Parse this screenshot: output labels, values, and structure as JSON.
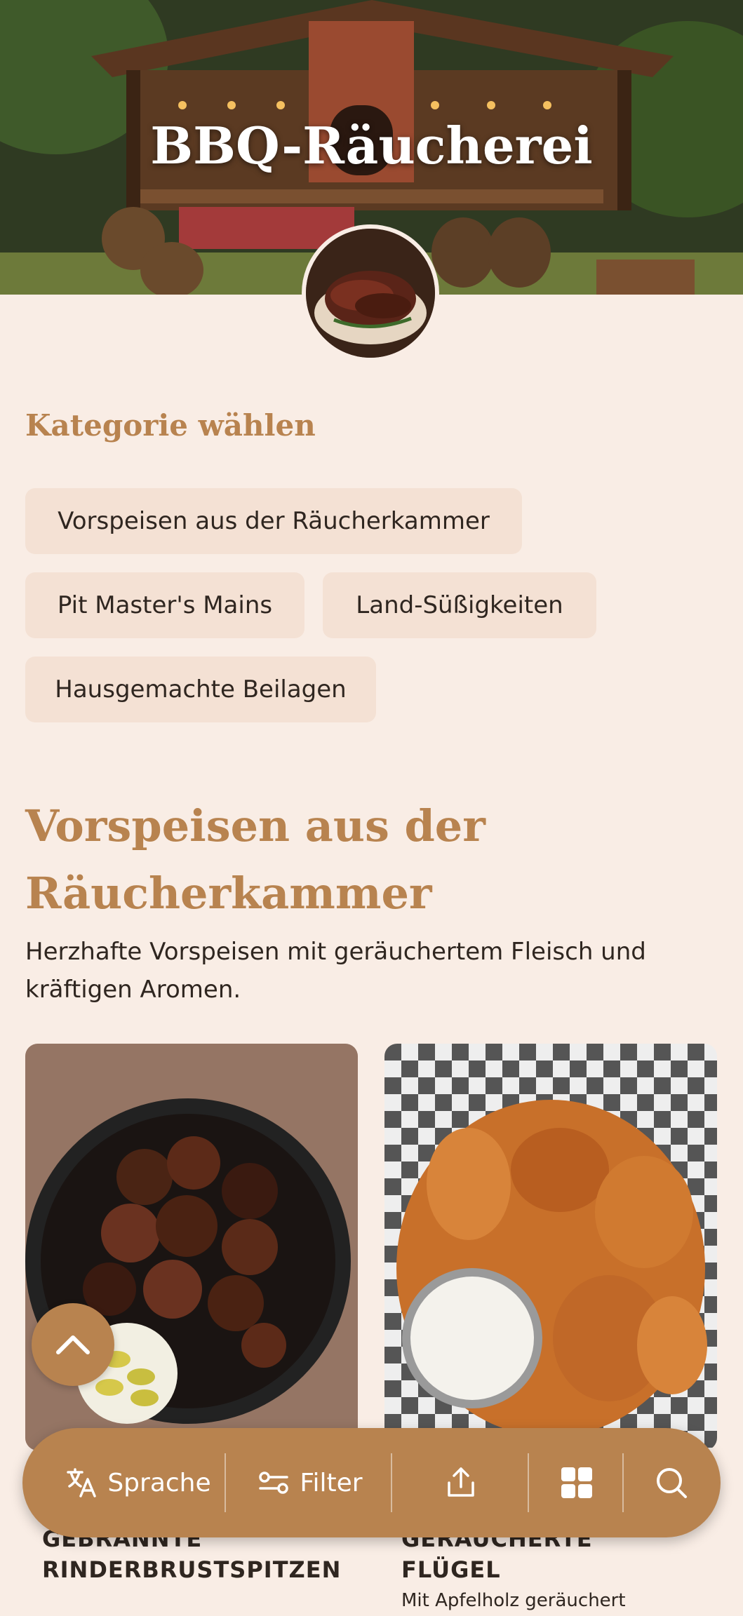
{
  "header": {
    "title": "BBQ-Räucherei"
  },
  "category_picker": {
    "label": "Kategorie wählen",
    "chips": [
      "Vorspeisen aus der Räucherkammer",
      "Pit Master's Mains",
      "Land-Süßigkeiten",
      "Hausgemachte Beilagen"
    ]
  },
  "category": {
    "title": "Vorspeisen aus der Räucherkammer",
    "description": "Herzhafte Vorspeisen mit geräuchertem Fleisch und kräftigen Aromen."
  },
  "items": [
    {
      "title_line1": "GEBRANNTE",
      "title_line2": "RINDERBRUSTSPITZEN"
    },
    {
      "title_line1": "GERÄUCHERTE FLÜGEL",
      "subtitle": "Mit Apfelholz geräuchert"
    }
  ],
  "bottom_bar": {
    "language_label": "Sprache",
    "filter_label": "Filter"
  },
  "colors": {
    "accent": "#b8834f",
    "background": "#f9ede5",
    "chip": "#f4e1d4",
    "text": "#2f2620"
  },
  "icons": [
    "translate-icon",
    "filter-icon",
    "share-icon",
    "grid-icon",
    "search-icon",
    "chevron-up-icon"
  ]
}
